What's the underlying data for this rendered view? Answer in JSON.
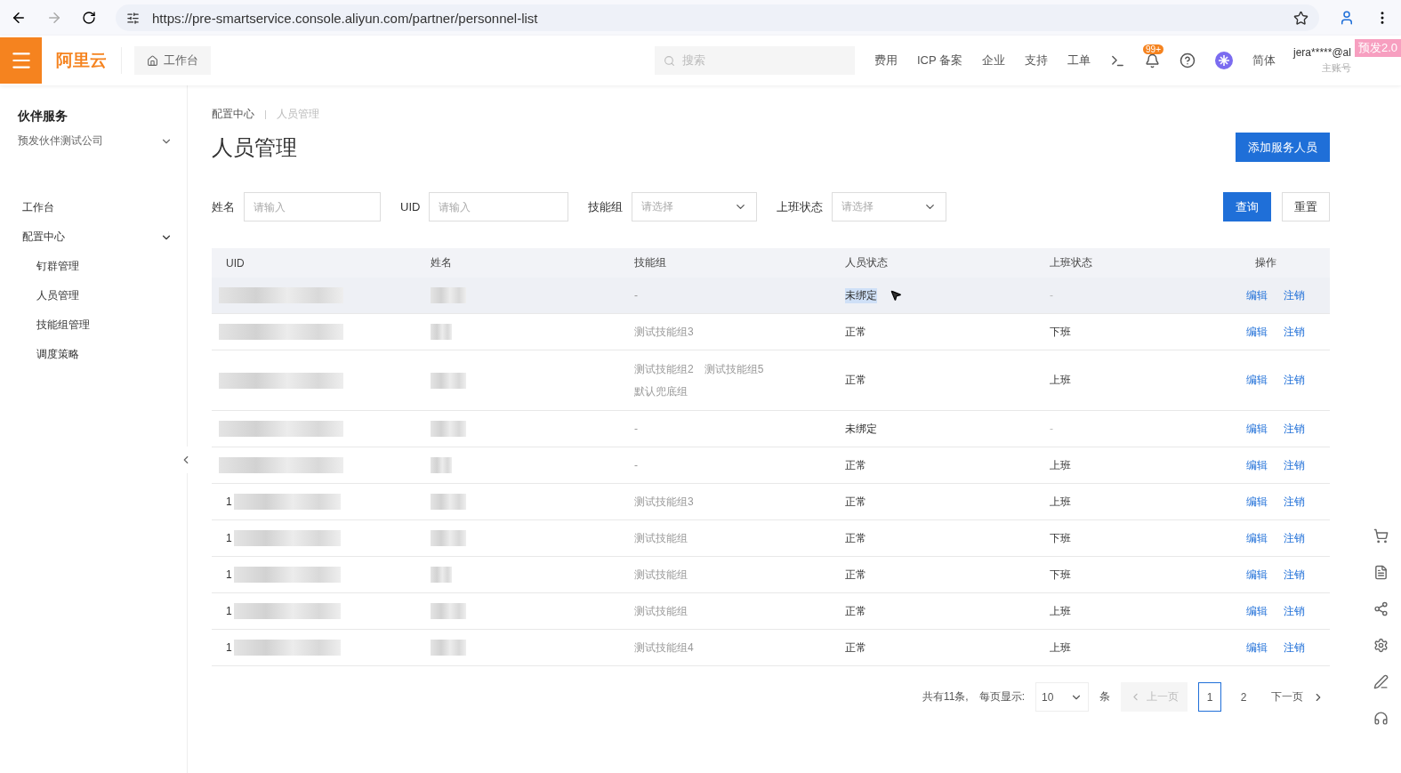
{
  "browser": {
    "url": "https://pre-smartservice.console.aliyun.com/partner/personnel-list"
  },
  "topbar": {
    "logo": "阿里云",
    "workbench": "工作台",
    "search_placeholder": "搜索",
    "links": [
      "费用",
      "ICP 备案",
      "企业",
      "支持",
      "工单"
    ],
    "notification_badge": "99+",
    "language": "简体",
    "account": "jera*****@al",
    "account_role": "主账号",
    "env_badge": "预发2.0"
  },
  "sidebar": {
    "title": "伙伴服务",
    "company": "预发伙伴测试公司",
    "items": [
      {
        "label": "工作台"
      },
      {
        "label": "配置中心",
        "expanded": true,
        "children": [
          {
            "label": "钉群管理"
          },
          {
            "label": "人员管理"
          },
          {
            "label": "技能组管理"
          },
          {
            "label": "调度策略"
          }
        ]
      }
    ]
  },
  "breadcrumb": [
    "配置中心",
    "人员管理"
  ],
  "page_title": "人员管理",
  "add_button": "添加服务人员",
  "filters": [
    {
      "kind": "input",
      "label": "姓名",
      "placeholder": "请输入"
    },
    {
      "kind": "input",
      "label": "UID",
      "placeholder": "请输入"
    },
    {
      "kind": "select",
      "label": "技能组",
      "placeholder": "请选择"
    },
    {
      "kind": "select",
      "label": "上班状态",
      "placeholder": "请选择"
    }
  ],
  "query_button": "查询",
  "reset_button": "重置",
  "table": {
    "columns": [
      "UID",
      "姓名",
      "技能组",
      "人员状态",
      "上班状态",
      "操作"
    ],
    "rows": [
      {
        "uid": "",
        "hovered": true,
        "skills": [
          "-"
        ],
        "status": "未绑定",
        "status_highlighted": true,
        "shift": "-",
        "actions": [
          "编辑",
          "注销"
        ]
      },
      {
        "uid": "",
        "hovered": false,
        "skills": [
          "测试技能组3"
        ],
        "status": "正常",
        "status_highlighted": false,
        "shift": "下班",
        "actions": [
          "编辑",
          "注销"
        ]
      },
      {
        "uid": "",
        "hovered": false,
        "skills": [
          "测试技能组2",
          "测试技能组5",
          "默认兜底组"
        ],
        "status": "正常",
        "status_highlighted": false,
        "shift": "上班",
        "actions": [
          "编辑",
          "注销"
        ]
      },
      {
        "uid": "",
        "hovered": false,
        "skills": [
          "-"
        ],
        "status": "未绑定",
        "status_highlighted": false,
        "shift": "-",
        "actions": [
          "编辑",
          "注销"
        ]
      },
      {
        "uid": "",
        "hovered": false,
        "skills": [
          "-"
        ],
        "status": "正常",
        "status_highlighted": false,
        "shift": "上班",
        "actions": [
          "编辑",
          "注销"
        ]
      },
      {
        "uid": "1",
        "hovered": false,
        "skills": [
          "测试技能组3"
        ],
        "status": "正常",
        "status_highlighted": false,
        "shift": "上班",
        "actions": [
          "编辑",
          "注销"
        ]
      },
      {
        "uid": "1",
        "hovered": false,
        "skills": [
          "测试技能组"
        ],
        "status": "正常",
        "status_highlighted": false,
        "shift": "下班",
        "actions": [
          "编辑",
          "注销"
        ]
      },
      {
        "uid": "1",
        "hovered": false,
        "skills": [
          "测试技能组"
        ],
        "status": "正常",
        "status_highlighted": false,
        "shift": "下班",
        "actions": [
          "编辑",
          "注销"
        ]
      },
      {
        "uid": "1",
        "hovered": false,
        "skills": [
          "测试技能组"
        ],
        "status": "正常",
        "status_highlighted": false,
        "shift": "上班",
        "actions": [
          "编辑",
          "注销"
        ]
      },
      {
        "uid": "1",
        "hovered": false,
        "skills": [
          "测试技能组4"
        ],
        "status": "正常",
        "status_highlighted": false,
        "shift": "上班",
        "actions": [
          "编辑",
          "注销"
        ]
      }
    ]
  },
  "pagination": {
    "total": "共有11条,",
    "page_size_label": "每页显示:",
    "page_size": "10",
    "unit": "条",
    "prev": "上一页",
    "next": "下一页",
    "pages": [
      {
        "label": "1",
        "selected": true
      },
      {
        "label": "2",
        "selected": false
      }
    ]
  }
}
